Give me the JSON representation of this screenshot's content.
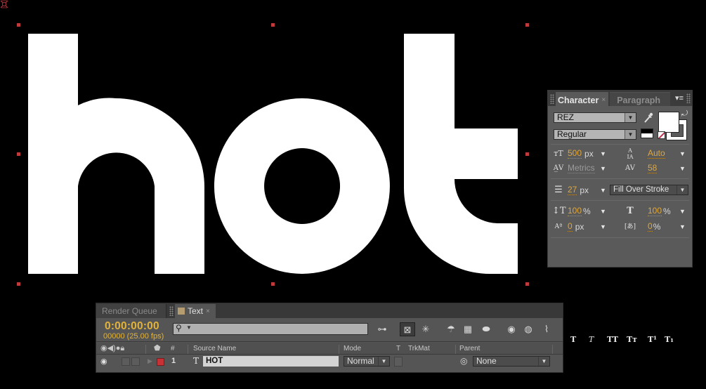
{
  "composition": {
    "text_layer_content": "hot",
    "background_color": "#000000",
    "text_color": "#ffffff",
    "handle_color": "#c0393b"
  },
  "character_panel": {
    "tabs": [
      {
        "label": "Character",
        "active": true,
        "close": "×"
      },
      {
        "label": "Paragraph",
        "active": false
      }
    ],
    "menu_icon": "▾≡",
    "font_family": "REZ",
    "font_style": "Regular",
    "fill_color": "#ffffff",
    "stroke_color": "#ffffff",
    "font_size": {
      "value": "500",
      "unit": "px"
    },
    "leading": {
      "value": "Auto"
    },
    "kerning": {
      "value": "Metrics"
    },
    "tracking": {
      "value": "58"
    },
    "stroke_width": {
      "value": "27",
      "unit": "px"
    },
    "stroke_mode": "Fill Over Stroke",
    "vertical_scale": {
      "value": "100",
      "unit": "%"
    },
    "horizontal_scale": {
      "value": "100",
      "unit": "%"
    },
    "baseline_shift": {
      "value": "0",
      "unit": "px"
    },
    "tsume": {
      "value": "0",
      "unit": "%"
    },
    "style_buttons": [
      {
        "name": "faux-bold",
        "glyph": "T"
      },
      {
        "name": "faux-italic",
        "glyph": "T"
      },
      {
        "name": "all-caps",
        "glyph": "TT"
      },
      {
        "name": "small-caps",
        "glyph": "Tт"
      },
      {
        "name": "superscript",
        "glyph": "T¹"
      },
      {
        "name": "subscript",
        "glyph": "T₁"
      }
    ],
    "accent_color": "#e0a63a"
  },
  "timeline": {
    "tabs": [
      {
        "label": "Render Queue",
        "active": false
      },
      {
        "label": "Text",
        "active": true,
        "close": "×"
      }
    ],
    "timecode": "0:00:00:00",
    "frame_info": "00000 (25.00 fps)",
    "search_placeholder": "",
    "columns": {
      "number": "#",
      "source_name": "Source Name",
      "mode": "Mode",
      "t": "T",
      "trkmat": "TrkMat",
      "parent": "Parent"
    },
    "layers": [
      {
        "number": "1",
        "type_icon": "T",
        "source_name": "HOT",
        "mode": "Normal",
        "parent": "None",
        "label_color": "#c63236"
      }
    ]
  }
}
